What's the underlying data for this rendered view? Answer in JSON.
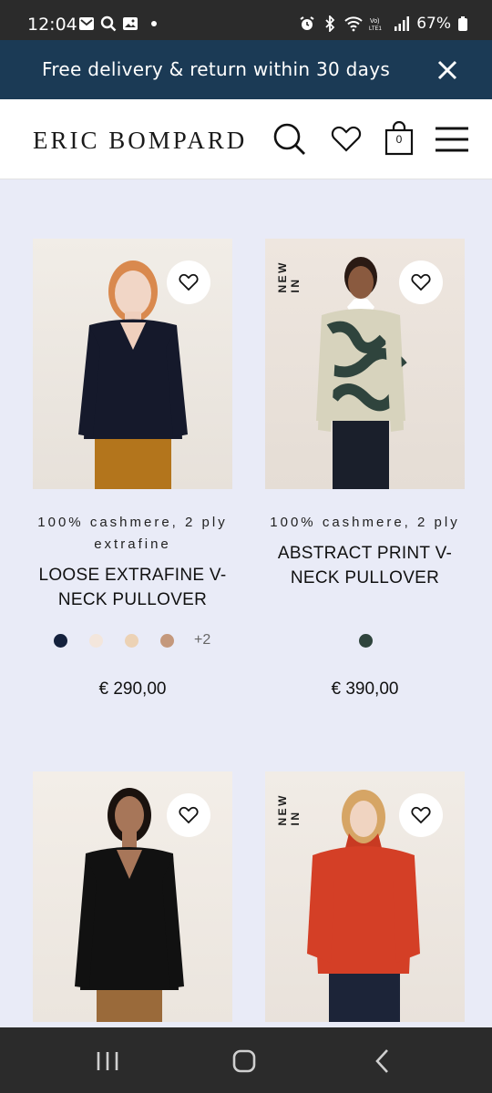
{
  "status_bar": {
    "time": "12:04",
    "battery": "67%",
    "icons": [
      "mail-icon",
      "search-icon",
      "image-icon",
      "alarm-icon",
      "bluetooth-icon",
      "wifi-icon",
      "volte-icon",
      "signal-icon",
      "battery-icon"
    ],
    "volte_label": "Vo)\nLTE1"
  },
  "promo": {
    "text": "Free delivery & return within 30 days"
  },
  "header": {
    "logo": "ERIC BOMPARD",
    "cart_count": "0"
  },
  "colors": {
    "accent": "#1b3a55",
    "page_bg": "#e9ebf7"
  },
  "products": [
    {
      "badge": "",
      "subtitle": "100% cashmere, 2 ply extrafine",
      "name": "LOOSE EXTRAFINE V-NECK PULLOVER",
      "swatches": [
        "#14213d",
        "#f3e6dc",
        "#ecd2b5",
        "#c4987c"
      ],
      "more_colors": "+2",
      "price": "€ 290,00"
    },
    {
      "badge": "NEW IN",
      "subtitle": "100% cashmere, 2 ply",
      "name": "ABSTRACT PRINT V-NECK PULLOVER",
      "swatches": [
        "#2f443d"
      ],
      "more_colors": "",
      "price": "€ 390,00"
    },
    {
      "badge": "",
      "subtitle": "",
      "name": "",
      "swatches": [],
      "more_colors": "",
      "price": ""
    },
    {
      "badge": "NEW IN",
      "subtitle": "",
      "name": "",
      "swatches": [],
      "more_colors": "",
      "price": ""
    }
  ]
}
